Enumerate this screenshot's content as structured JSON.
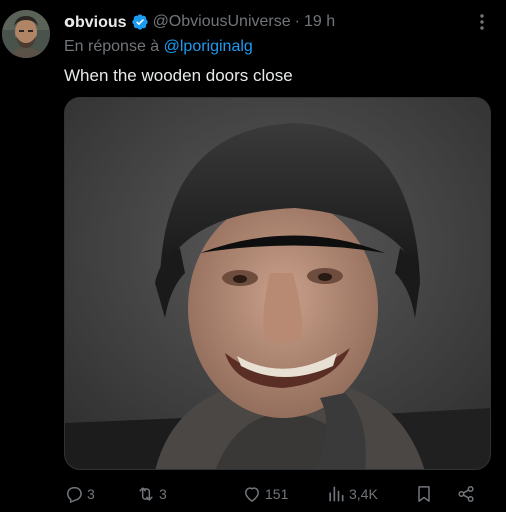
{
  "tweet": {
    "display_name": "𝗼bvious",
    "handle": "@ObviousUniverse",
    "separator": "·",
    "time": "19 h",
    "reply_prefix": "En réponse à ",
    "reply_to": "@lporiginalg",
    "text": "When the wooden doors close"
  },
  "actions": {
    "replies": "3",
    "reposts": "3",
    "likes": "151",
    "views": "3,4K"
  },
  "icons": {
    "verified": "verified-badge-icon",
    "more": "more-dots-icon",
    "reply": "reply-icon",
    "repost": "repost-icon",
    "like": "heart-icon",
    "views": "views-chart-icon",
    "bookmark": "bookmark-icon",
    "share": "share-icon"
  },
  "colors": {
    "background": "#000000",
    "primary_text": "#e7e9ea",
    "secondary_text": "#71767b",
    "link": "#1d9bf0",
    "verified": "#1d9bf0"
  }
}
